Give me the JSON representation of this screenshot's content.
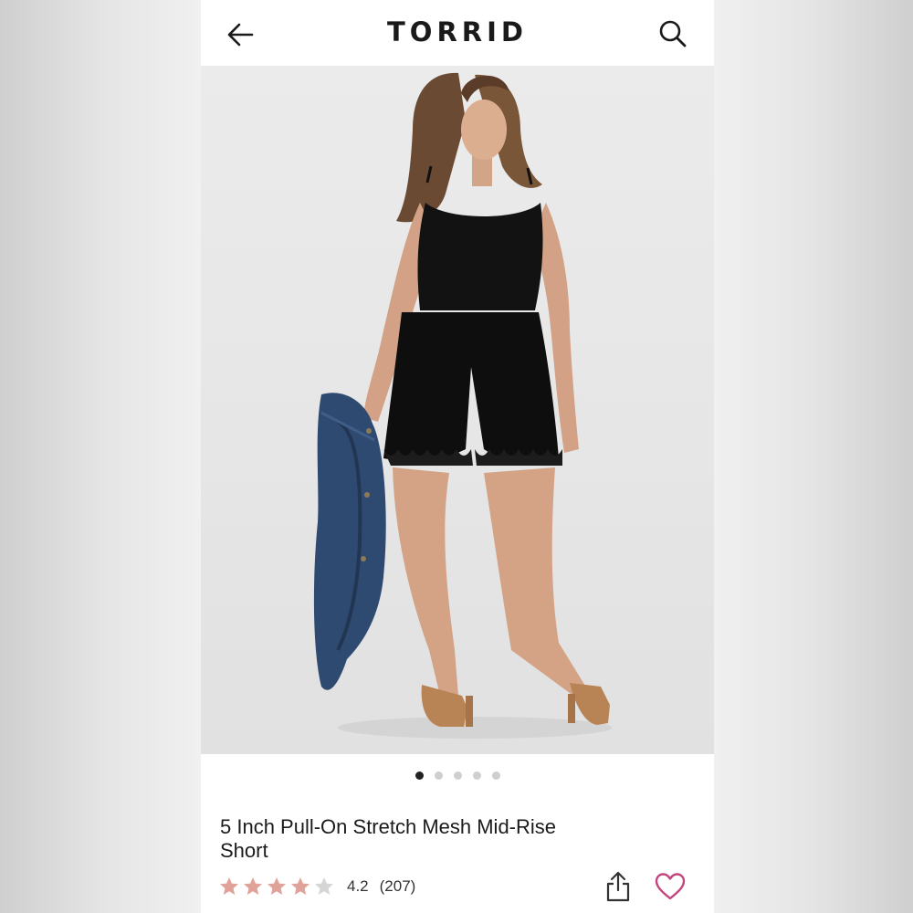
{
  "header": {
    "brand": "TORRID",
    "back_icon": "arrow-left-icon",
    "search_icon": "search-icon"
  },
  "gallery": {
    "image_count": 5,
    "active_index": 0
  },
  "product": {
    "title": "5 Inch Pull-On Stretch Mesh Mid-Rise Short",
    "rating": 4.2,
    "rating_display": "4.2",
    "review_count": "(207)",
    "star_color": "#e0a399",
    "star_empty_color": "#d6d6d6"
  },
  "actions": {
    "share_icon": "share-icon",
    "wishlist_icon": "heart-icon",
    "wishlist_color": "#c2457d"
  }
}
